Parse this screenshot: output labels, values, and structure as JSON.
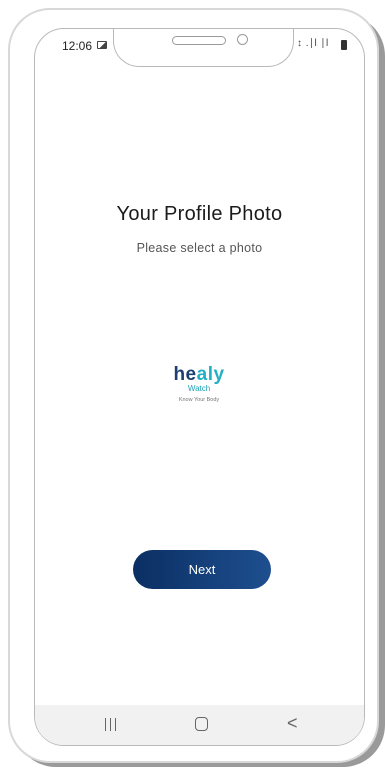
{
  "status_bar": {
    "time": "12:06",
    "image_icon": "image-icon",
    "signal_text": "↕ .∣l ∣l",
    "battery_icon": "battery-icon"
  },
  "screen": {
    "title": "Your Profile Photo",
    "subtitle": "Please select a photo"
  },
  "logo": {
    "word_part1": "he",
    "word_part2": "aly",
    "sub": "Watch",
    "tagline": "Know Your Body"
  },
  "next_button": {
    "label": "Next",
    "color_start": "#0b2f63",
    "color_end": "#1e4f8f"
  },
  "nav_bar": {
    "recents_icon": "recents-icon",
    "home_icon": "home-icon",
    "back_icon": "back-icon",
    "back_glyph": "<"
  }
}
